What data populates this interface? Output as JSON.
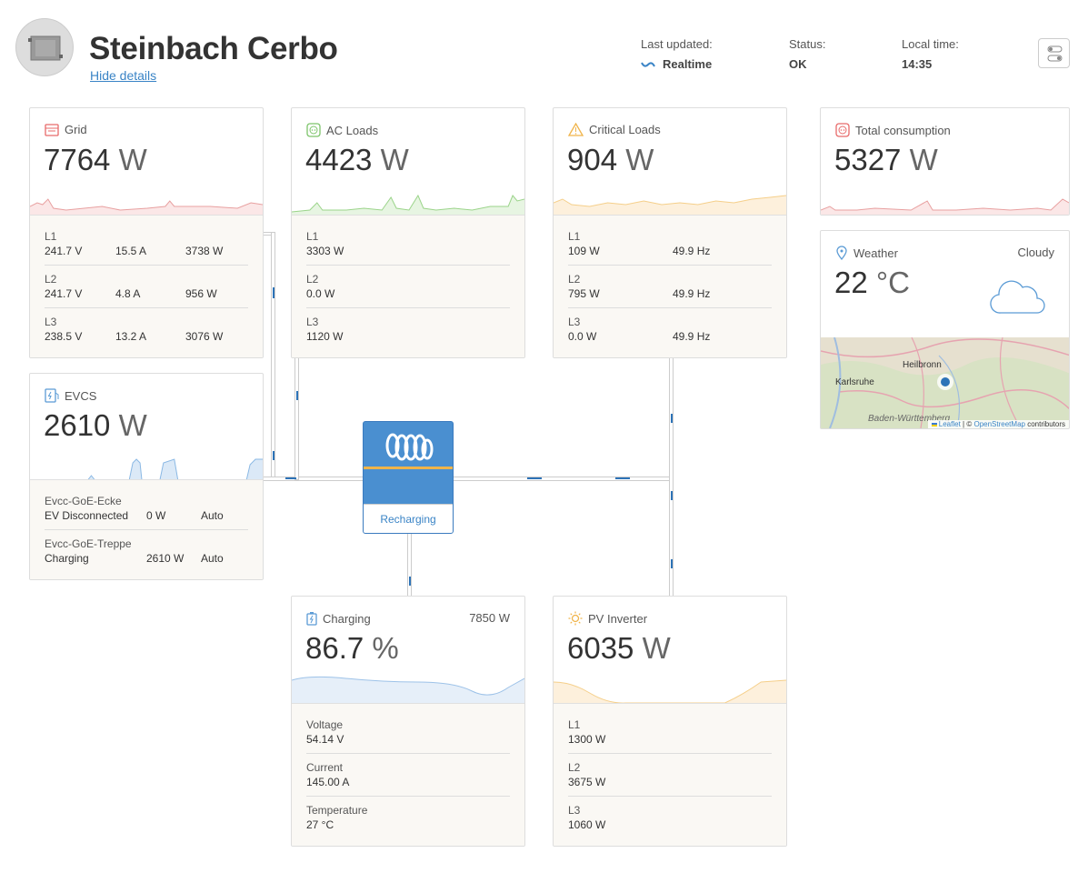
{
  "header": {
    "title": "Steinbach Cerbo",
    "hide_details": "Hide details",
    "last_updated_label": "Last updated:",
    "last_updated_value": "Realtime",
    "status_label": "Status:",
    "status_value": "OK",
    "local_time_label": "Local time:",
    "local_time_value": "14:35"
  },
  "grid": {
    "title": "Grid",
    "value": "7764",
    "unit": "W",
    "rows": [
      {
        "label": "L1",
        "v": "241.7 V",
        "a": "15.5 A",
        "w": "3738 W"
      },
      {
        "label": "L2",
        "v": "241.7 V",
        "a": "4.8 A",
        "w": "956 W"
      },
      {
        "label": "L3",
        "v": "238.5 V",
        "a": "13.2 A",
        "w": "3076 W"
      }
    ]
  },
  "ac_loads": {
    "title": "AC Loads",
    "value": "4423",
    "unit": "W",
    "rows": [
      {
        "label": "L1",
        "w": "3303 W"
      },
      {
        "label": "L2",
        "w": "0.0 W"
      },
      {
        "label": "L3",
        "w": "1120 W"
      }
    ]
  },
  "critical_loads": {
    "title": "Critical Loads",
    "value": "904",
    "unit": "W",
    "rows": [
      {
        "label": "L1",
        "w": "109 W",
        "hz": "49.9 Hz"
      },
      {
        "label": "L2",
        "w": "795 W",
        "hz": "49.9 Hz"
      },
      {
        "label": "L3",
        "w": "0.0 W",
        "hz": "49.9 Hz"
      }
    ]
  },
  "total_consumption": {
    "title": "Total consumption",
    "value": "5327",
    "unit": "W"
  },
  "weather": {
    "title": "Weather",
    "condition": "Cloudy",
    "value": "22",
    "unit": "°C",
    "map_cities": [
      "Heilbronn",
      "Karlsruhe",
      "Baden-Württemberg"
    ],
    "map_attrib_leaflet": "Leaflet",
    "map_attrib_sep": "|",
    "map_attrib_copy": "©",
    "map_attrib_osm": "OpenStreetMap",
    "map_attrib_rest": "contributors"
  },
  "evcs": {
    "title": "EVCS",
    "value": "2610",
    "unit": "W",
    "chargers": [
      {
        "name": "Evcc-GoE-Ecke",
        "state": "EV Disconnected",
        "power": "0 W",
        "mode": "Auto"
      },
      {
        "name": "Evcc-GoE-Treppe",
        "state": "Charging",
        "power": "2610 W",
        "mode": "Auto"
      }
    ]
  },
  "inverter": {
    "label": "Recharging"
  },
  "battery": {
    "title": "Charging",
    "power": "7850 W",
    "value": "86.7",
    "unit": "%",
    "rows": [
      {
        "label": "Voltage",
        "val": "54.14 V"
      },
      {
        "label": "Current",
        "val": "145.00 A"
      },
      {
        "label": "Temperature",
        "val": "27 °C"
      }
    ]
  },
  "pv_inverter": {
    "title": "PV Inverter",
    "value": "6035",
    "unit": "W",
    "rows": [
      {
        "label": "L1",
        "w": "1300 W"
      },
      {
        "label": "L2",
        "w": "3675 W"
      },
      {
        "label": "L3",
        "w": "1060 W"
      }
    ]
  },
  "colors": {
    "accent": "#3a84c6",
    "grid": "#e86a6a",
    "acloads": "#7cc46a",
    "critical": "#f0b44a",
    "battery": "#5b9bd5",
    "pv": "#f0b44a"
  }
}
